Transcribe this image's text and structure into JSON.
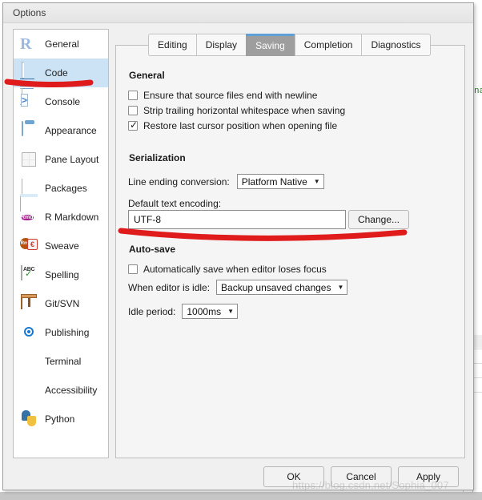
{
  "window": {
    "title": "Options"
  },
  "sidebar": {
    "items": [
      {
        "label": "General",
        "icon": "r-logo-icon",
        "selected": false
      },
      {
        "label": "Code",
        "icon": "code-document-icon",
        "selected": true
      },
      {
        "label": "Console",
        "icon": "console-prompt-icon",
        "selected": false
      },
      {
        "label": "Appearance",
        "icon": "paint-bucket-icon",
        "selected": false
      },
      {
        "label": "Pane Layout",
        "icon": "pane-grid-icon",
        "selected": false
      },
      {
        "label": "Packages",
        "icon": "package-box-icon",
        "selected": false
      },
      {
        "label": "R Markdown",
        "icon": "rmd-badge-icon",
        "selected": false
      },
      {
        "label": "Sweave",
        "icon": "sweave-pdf-icon",
        "selected": false
      },
      {
        "label": "Spelling",
        "icon": "spellcheck-icon",
        "selected": false
      },
      {
        "label": "Git/SVN",
        "icon": "git-box-icon",
        "selected": false
      },
      {
        "label": "Publishing",
        "icon": "publishing-icon",
        "selected": false
      },
      {
        "label": "Terminal",
        "icon": "terminal-icon",
        "selected": false
      },
      {
        "label": "Accessibility",
        "icon": "accessibility-icon",
        "selected": false
      },
      {
        "label": "Python",
        "icon": "python-icon",
        "selected": false
      }
    ]
  },
  "tabs": [
    {
      "label": "Editing",
      "active": false
    },
    {
      "label": "Display",
      "active": false
    },
    {
      "label": "Saving",
      "active": true
    },
    {
      "label": "Completion",
      "active": false
    },
    {
      "label": "Diagnostics",
      "active": false
    }
  ],
  "saving": {
    "general": {
      "heading": "General",
      "checkboxes": [
        {
          "label": "Ensure that source files end with newline",
          "checked": false
        },
        {
          "label": "Strip trailing horizontal whitespace when saving",
          "checked": false
        },
        {
          "label": "Restore last cursor position when opening file",
          "checked": true
        }
      ]
    },
    "serialization": {
      "heading": "Serialization",
      "line_ending_label": "Line ending conversion:",
      "line_ending_value": "Platform Native",
      "encoding_label": "Default text encoding:",
      "encoding_value": "UTF-8",
      "change_button": "Change..."
    },
    "autosave": {
      "heading": "Auto-save",
      "checkbox": {
        "label": "Automatically save when editor loses focus",
        "checked": false
      },
      "idle_label": "When editor is idle:",
      "idle_value": "Backup unsaved changes",
      "period_label": "Idle period:",
      "period_value": "1000ms"
    }
  },
  "footer": {
    "ok": "OK",
    "cancel": "Cancel",
    "apply": "Apply"
  },
  "background_window": {
    "code_fragment": "na"
  },
  "watermark": "https://blog.csdn.net/Sophia_007",
  "colors": {
    "selection_blue": "#cce3f5",
    "active_tab_bg": "#9e9e9e",
    "active_tab_accent": "#5d9fd6",
    "annotation_red": "#e01b1b",
    "dialog_bg": "#f0f0f0"
  }
}
